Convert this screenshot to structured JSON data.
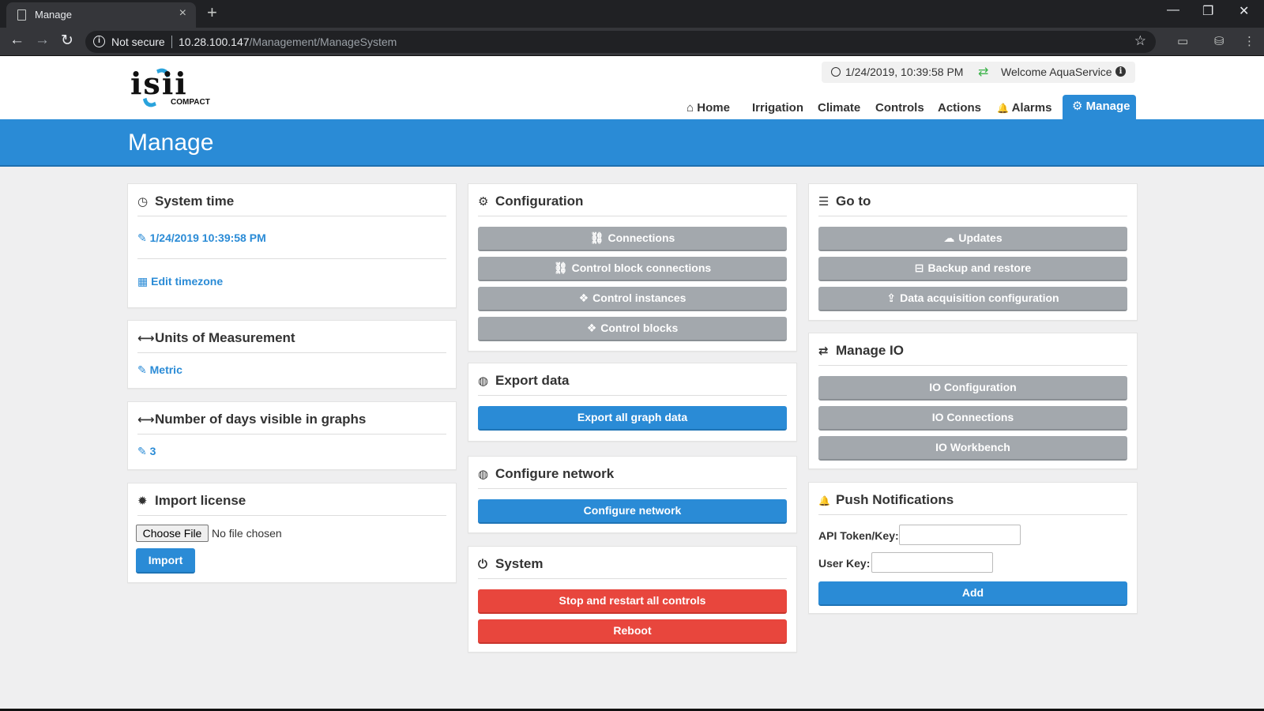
{
  "browser": {
    "tab_title": "Manage",
    "close_glyph": "×",
    "newtab_glyph": "+",
    "minimize_glyph": "—",
    "restore_glyph": "❐",
    "winclose_glyph": "✕",
    "back_glyph": "←",
    "forward_glyph": "→",
    "reload_glyph": "↻",
    "not_secure": "Not secure",
    "url_host": "10.28.100.147",
    "url_path": "/Management/ManageSystem",
    "star_glyph": "☆"
  },
  "header": {
    "logo_text": "isii",
    "logo_sub": "COMPACT",
    "datetime": "1/24/2019, 10:39:58 PM",
    "sync_glyph": "⇄",
    "welcome": "Welcome AquaService",
    "info_glyph": "i",
    "nav": [
      {
        "icon": "⌂",
        "label": "Home"
      },
      {
        "label": "Irrigation"
      },
      {
        "label": "Climate"
      },
      {
        "label": "Controls"
      },
      {
        "label": "Actions"
      },
      {
        "icon": "🔔",
        "label": "Alarms"
      },
      {
        "icon": "⚙",
        "label": "Manage"
      }
    ]
  },
  "banner": {
    "title": "Manage"
  },
  "system_time": {
    "title": "System time",
    "value": "1/24/2019 10:39:58 PM",
    "edit_timezone": "Edit timezone"
  },
  "units": {
    "title": "Units of Measurement",
    "value": "Metric"
  },
  "days_visible": {
    "title": "Number of days visible in graphs",
    "value": "3"
  },
  "license": {
    "title": "Import license",
    "choose_file": "Choose File",
    "no_file": "No file chosen",
    "import_label": "Import"
  },
  "configuration": {
    "title": "Configuration",
    "buttons": [
      "Connections",
      "Control block connections",
      "Control instances",
      "Control blocks"
    ]
  },
  "export": {
    "title": "Export data",
    "button": "Export all graph data"
  },
  "network": {
    "title": "Configure network",
    "button": "Configure network"
  },
  "system": {
    "title": "System",
    "restart": "Stop and restart all controls",
    "reboot": "Reboot"
  },
  "goto": {
    "title": "Go to",
    "buttons": [
      "Updates",
      "Backup and restore",
      "Data acquisition configuration"
    ]
  },
  "manage_io": {
    "title": "Manage IO",
    "buttons": [
      "IO Configuration",
      "IO Connections",
      "IO Workbench"
    ]
  },
  "push": {
    "title": "Push Notifications",
    "api_label": "API Token/Key:",
    "user_label": "User Key:",
    "add_label": "Add"
  },
  "icons": {
    "pencil": "✎",
    "calendar": "▦",
    "hscroll": "⟷",
    "gear": "✹",
    "cogs": "⚙",
    "globe": "◍",
    "power": "⏻",
    "list": "☰",
    "exchange": "⇄",
    "bell": "🔔",
    "link": "⛓",
    "cubes": "❖",
    "cloud": "☁",
    "drive": "⊟",
    "upload": "⇪"
  }
}
